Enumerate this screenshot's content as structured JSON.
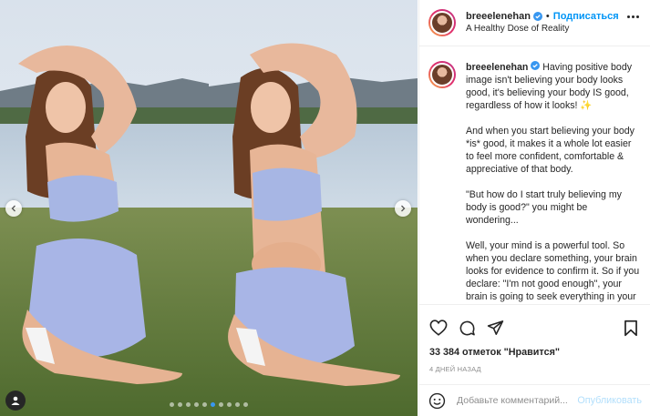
{
  "post": {
    "username": "breeelenehan",
    "follow_label": "Подписаться",
    "location": "A Healthy Dose of Reality",
    "likes_text": "33 384 отметок \"Нравится\"",
    "time_text": "4 ДНЕЙ НАЗАД"
  },
  "caption": {
    "username": "breeelenehan",
    "p1": " Having positive body image isn't believing your body looks good, it's believing your body IS good, regardless of how it looks! ✨",
    "p2": "And when you start believing your body *is* good, it makes it a whole lot easier to feel more confident, comfortable & appreciative of that body.",
    "p3": "\"But how do I start truly believing my body is good?\" you might be wondering...",
    "p4": "Well, your mind is a powerful tool. So when you declare something, your brain looks for evidence to confirm it. So if you declare: \"I'm not good enough\", your brain is going to seek everything in your"
  },
  "comment": {
    "placeholder": "Добавьте комментарий...",
    "post_label": "Опубликовать"
  },
  "carousel": {
    "dot_count": 10,
    "active_index": 5
  },
  "icons": {
    "verified": "verified-badge-icon",
    "like": "heart-icon",
    "comment": "comment-bubble-icon",
    "share": "paper-plane-icon",
    "save": "bookmark-icon",
    "emoji": "smiley-icon",
    "more": "ellipsis-icon",
    "prev": "chevron-left-icon",
    "next": "chevron-right-icon",
    "tag": "user-tag-icon"
  },
  "colors": {
    "accent": "#0095f6",
    "verified": "#3897f0",
    "post_disabled": "#b2dffc",
    "muted": "#8e8e8e"
  }
}
